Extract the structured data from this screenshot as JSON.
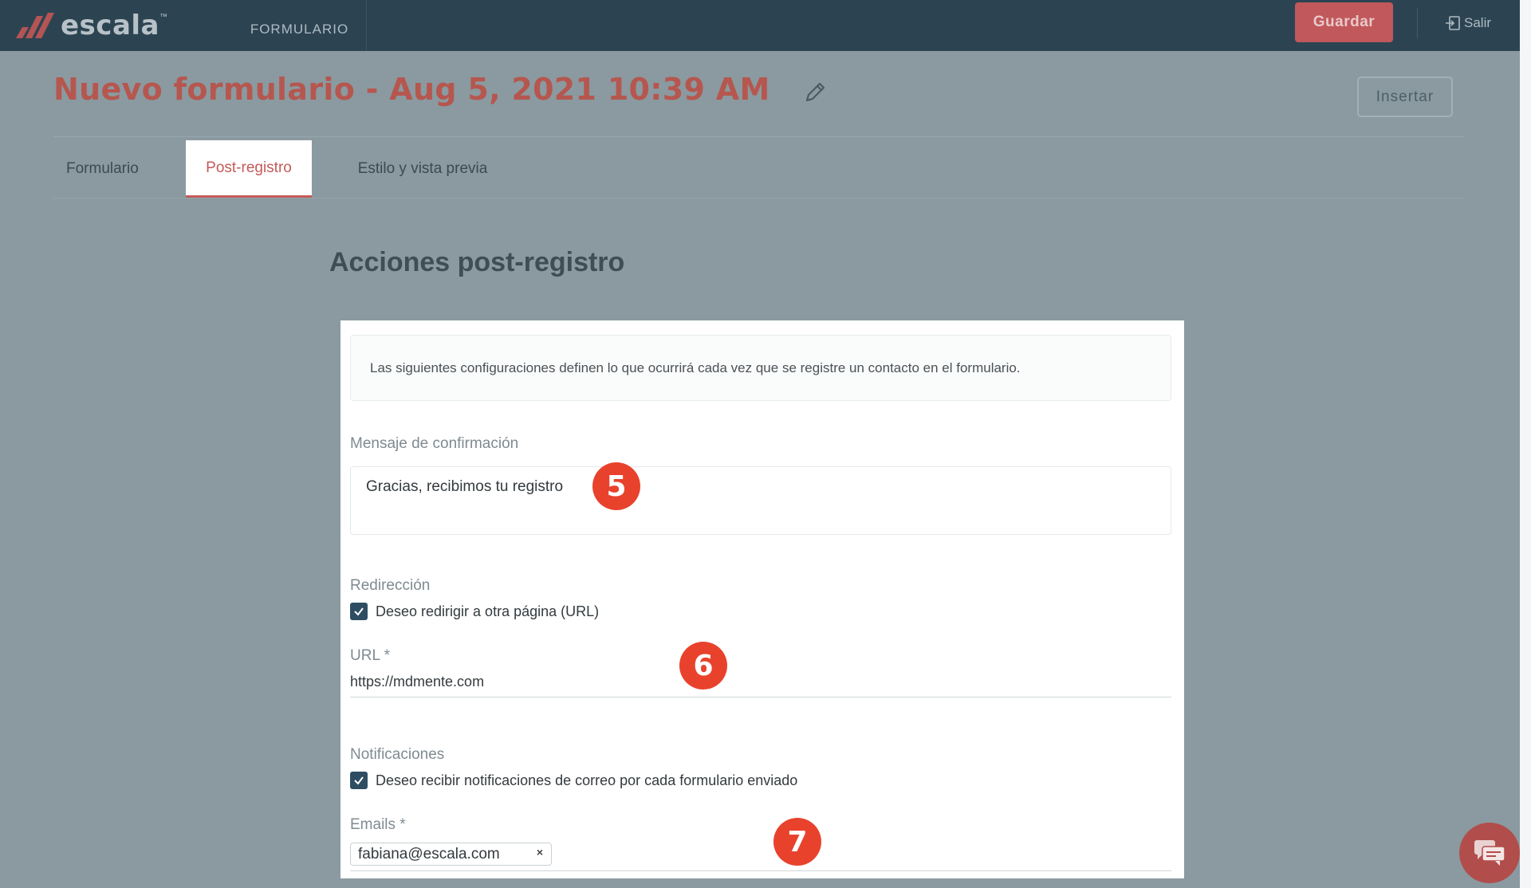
{
  "app": {
    "brand": "escala",
    "brand_tm": "™",
    "section": "FORMULARIO"
  },
  "topbar": {
    "save_label": "Guardar",
    "logout_label": "Salir"
  },
  "header": {
    "title": "Nuevo formulario - Aug 5, 2021 10:39 AM",
    "insert_label": "Insertar"
  },
  "tabs": [
    {
      "label": "Formulario",
      "active": false
    },
    {
      "label": "Post-registro",
      "active": true
    },
    {
      "label": "Estilo y vista previa",
      "active": false
    }
  ],
  "main": {
    "section_title": "Acciones post-registro",
    "info_text": "Las siguientes configuraciones definen lo que ocurrirá cada vez que se registre un contacto en el formulario.",
    "confirmation": {
      "label": "Mensaje de confirmación",
      "value": "Gracias, recibimos tu registro"
    },
    "redirect": {
      "label": "Redirección",
      "checkbox_label": "Deseo redirigir a otra página (URL)",
      "checked": true,
      "url_label": "URL *",
      "url_value": "https://mdmente.com"
    },
    "notifications": {
      "label": "Notificaciones",
      "checkbox_label": "Deseo recibir notificaciones de correo por cada formulario enviado",
      "checked": true,
      "emails_label": "Emails *",
      "emails": [
        "fabiana@escala.com"
      ],
      "chip_remove": "×"
    }
  },
  "callouts": [
    "5",
    "6",
    "7"
  ],
  "icons": {
    "edit": "pencil-icon",
    "logout": "logout-icon",
    "check": "checkmark-icon",
    "chat": "chat-bubbles-icon"
  },
  "colors": {
    "topbar": "#2c4452",
    "accent": "#c45a58",
    "callout": "#e8422d",
    "checkbox": "#2e4d63"
  }
}
